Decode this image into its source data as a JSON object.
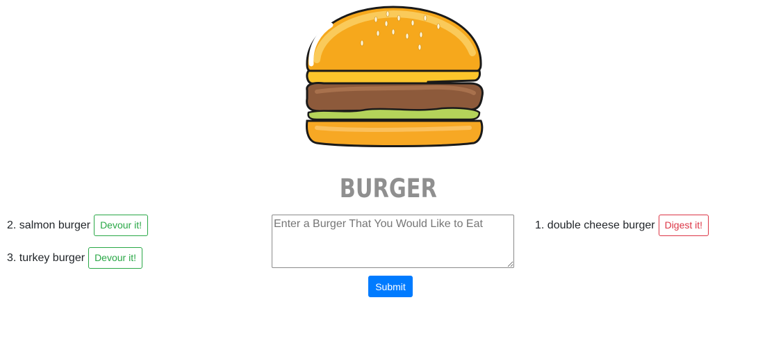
{
  "header": {
    "logo_icon": "burger-illustration-icon",
    "title": "BURGER"
  },
  "uneaten": {
    "items": [
      {
        "label": "2. salmon burger",
        "button": "Devour it!"
      },
      {
        "label": "3. turkey burger",
        "button": "Devour it!"
      }
    ]
  },
  "form": {
    "placeholder": "Enter a Burger That You Would Like to Eat",
    "value": "",
    "submit_label": "Submit"
  },
  "devoured": {
    "items": [
      {
        "label": "1. double cheese burger",
        "button": "Digest it!"
      }
    ]
  },
  "colors": {
    "devour": "#28a745",
    "digest": "#dc3545",
    "submit": "#007bff",
    "title": "#8f8f8f"
  }
}
